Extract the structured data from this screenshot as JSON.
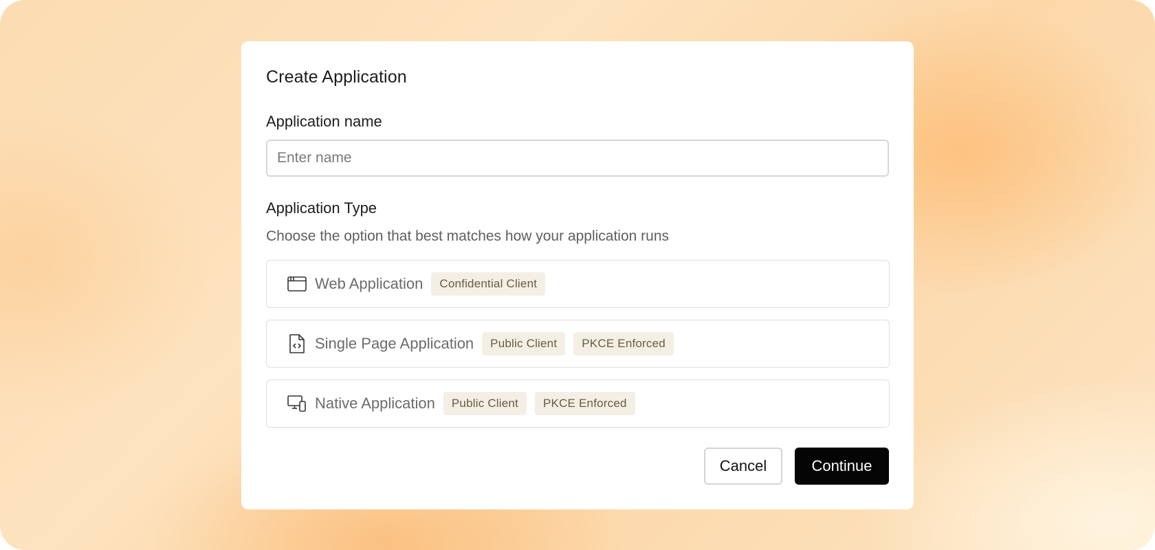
{
  "dialog": {
    "title": "Create Application",
    "name_label": "Application name",
    "name_placeholder": "Enter name",
    "name_value": "",
    "type_label": "Application Type",
    "type_helper": "Choose the option that best matches how your application runs",
    "options": [
      {
        "label": "Web Application",
        "icon": "browser-window-icon",
        "badges": [
          "Confidential Client"
        ]
      },
      {
        "label": "Single Page Application",
        "icon": "code-file-icon",
        "badges": [
          "Public Client",
          "PKCE Enforced"
        ]
      },
      {
        "label": "Native Application",
        "icon": "devices-icon",
        "badges": [
          "Public Client",
          "PKCE Enforced"
        ]
      }
    ],
    "cancel_label": "Cancel",
    "continue_label": "Continue"
  },
  "colors": {
    "primary_button": "#050505",
    "badge_background": "#f4efe5",
    "badge_text": "#6a5a3e"
  }
}
